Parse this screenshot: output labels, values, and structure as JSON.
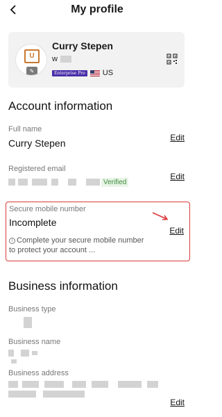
{
  "header": {
    "title": "My profile"
  },
  "profile": {
    "name": "Curry Stepen",
    "sub_initial": "w",
    "badge": "Enterprise Pro",
    "country": "US"
  },
  "account": {
    "title": "Account information",
    "full_name": {
      "label": "Full name",
      "value": "Curry Stepen",
      "edit": "Edit"
    },
    "email": {
      "label": "Registered email",
      "status": "Verified",
      "edit": "Edit"
    },
    "mobile": {
      "label": "Secure mobile number",
      "value": "Incomplete",
      "note": "Complete your secure mobile number to protect your account ...",
      "edit": "Edit"
    }
  },
  "business": {
    "title": "Business information",
    "type": {
      "label": "Business type"
    },
    "name": {
      "label": "Business name"
    },
    "address": {
      "label": "Business address",
      "edit": "Edit"
    }
  },
  "colors": {
    "highlight_border": "#d93a3a",
    "verified_text": "#3f8a3f",
    "badge_bg": "#4a2ea8"
  },
  "icons": [
    "back-icon",
    "avatar-edit-icon",
    "qr-code-icon",
    "info-icon",
    "arrow-icon"
  ]
}
